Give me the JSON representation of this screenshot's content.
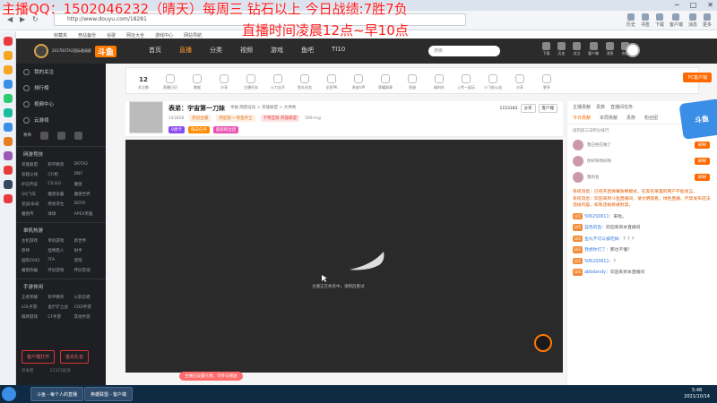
{
  "overlay": {
    "line1": "主播QQ：1502046232（晴天）每周三 钻石以上 今日战绩:7胜7负",
    "line2": "直播时间凌晨12点~早10点"
  },
  "browser": {
    "url": "http://www.douyu.com/18281",
    "search_placeholder": "魅力直播推荐"
  },
  "bookmarks": [
    "收藏夹",
    "竞站备份",
    "谷歌",
    "网址大全",
    "游戏中心",
    "网站导航"
  ],
  "browser_tools": [
    "历史",
    "书签",
    "下载",
    "客户端",
    "消息",
    "更多"
  ],
  "header": {
    "logo_text": "2017DOTA2国际邀请赛",
    "brand": "斗鱼",
    "nav": [
      "首页",
      "直播",
      "分类",
      "视频",
      "游戏",
      "鱼吧",
      "TI10"
    ],
    "active_nav": "直播",
    "search_placeholder": "搜索",
    "right_items": [
      "下载",
      "历史",
      "关注",
      "客户端",
      "消息",
      "充值"
    ]
  },
  "sidebar": {
    "items": [
      "我的关注",
      "排行榜",
      "视频中心",
      "云游戏"
    ],
    "icon_row": [
      "赛事",
      "",
      "",
      ""
    ],
    "sections": [
      {
        "title": "网游竞技",
        "items": [
          "英雄联盟",
          "和平精英",
          "DOTA2",
          "穿越火线",
          "CF/枪",
          "DNF",
          "炉石传说",
          "CS:GO",
          "魔兽",
          "QQ飞车",
          "魔兽争霸",
          "魔兽世界",
          "逆战/永劫",
          "绝地求生",
          "DOTA",
          "魔兽传",
          "球球",
          "APEX英雄"
        ]
      },
      {
        "title": "单机热游",
        "items": [
          "主机游戏",
          "单机游戏",
          "新世界",
          "原神",
          "怪物猎人",
          "射手",
          "国际2042",
          "FFA",
          "黑暗",
          "魔兽改编",
          "怀旧游戏",
          "怀旧其他"
        ]
      },
      {
        "title": "手游休闲",
        "items": [
          "王者荣耀",
          "和平精英",
          "火影忍者",
          "LOL手游",
          "金铲铲之战",
          "COD手游",
          "棋牌游戏",
          "CF手游",
          "其他手游"
        ]
      }
    ],
    "bottom_buttons": [
      "客户端打开",
      "首充礼包"
    ],
    "footer": [
      "开发者",
      "12315投诉"
    ]
  },
  "gifts": [
    {
      "label": "关注数",
      "num": "12"
    },
    {
      "label": "直播日历"
    },
    {
      "label": "数据"
    },
    {
      "label": "分享"
    },
    {
      "label": "主播任务"
    },
    {
      "label": "火力全开"
    },
    {
      "label": "鱼丸任务"
    },
    {
      "label": "全民PK"
    },
    {
      "label": "贵族VIP"
    },
    {
      "label": "荣耀勋章"
    },
    {
      "label": "鱼翅"
    },
    {
      "label": "福利社"
    },
    {
      "label": "上传一起玩"
    },
    {
      "label": "小飞船公益"
    },
    {
      "label": "分享"
    },
    {
      "label": "更多"
    }
  ],
  "pc_button": "PC客户端",
  "streamer": {
    "title": "表弟：宇宙第一刀妹",
    "mini": "举报  网游竞技 > 英雄联盟 > 大神秀",
    "followers": "141858",
    "tags": [
      "原创主播",
      "周星第一·青金术士",
      "卡特互联·英雄联盟",
      "599+kg"
    ],
    "row3": [
      "9周卡",
      "每日任务",
      "超级粉丝团"
    ],
    "right": [
      "1153183",
      "分享",
      "客户端"
    ]
  },
  "video": {
    "caption": "主播正在休息中，请稍后重试",
    "promo": "主播已设置礼物，可参与赠送"
  },
  "right_panel": {
    "head": [
      "主播贡献",
      "贵族",
      "直播间任务"
    ],
    "tabs": [
      "今日贡献",
      "本周贡献",
      "贵族",
      "粉丝团"
    ],
    "badge": "斗鱼",
    "sub": "排列前三日积分排行",
    "ranks": [
      {
        "name": "我已经在做了",
        "btn": "刷刷"
      },
      {
        "name": "你好呀你好呀",
        "btn": "刷刷"
      },
      {
        "name": "我的名",
        "btn": "刷刷"
      }
    ],
    "chat": [
      {
        "type": "sys",
        "text": "系统消息：已经开启弹幕防刷模式，在黑名单里的用户不能发言。"
      },
      {
        "type": "sys",
        "text": "系统消息：欢迎来到斗鱼直播间，请文明观看，绿色直播，严禁发布违法违规内容，如有违规将被封禁。"
      },
      {
        "type": "msg",
        "level": "LV1",
        "user": "5062S0611：",
        "text": "来啦。"
      },
      {
        "type": "msg",
        "level": "LV5",
        "user": "蓝色的鱼：",
        "text": "欢迎来到本直播间"
      },
      {
        "type": "msg",
        "level": "LV3",
        "user": "鱼丸不可以被吃掉：",
        "text": "？？？"
      },
      {
        "type": "msg",
        "level": "LV2",
        "user": "我想你们了：",
        "text": "那也不懂？"
      },
      {
        "type": "msg",
        "level": "LV1",
        "user": "5062S0611：",
        "text": "？"
      },
      {
        "type": "msg",
        "level": "LV4",
        "user": "abbdandy：",
        "text": "欢迎来到本直播间"
      }
    ]
  },
  "taskbar": {
    "apps": [
      "斗鱼 - 每个人的直播",
      "英雄联盟 - 客户端"
    ],
    "time": "5:48",
    "date": "2021/10/14"
  },
  "colors": {
    "accent": "#ff6a00",
    "overlay_text": "#ff1e1e",
    "header_bg": "#2b2b2b",
    "sidebar_bg": "#1d1f23"
  }
}
